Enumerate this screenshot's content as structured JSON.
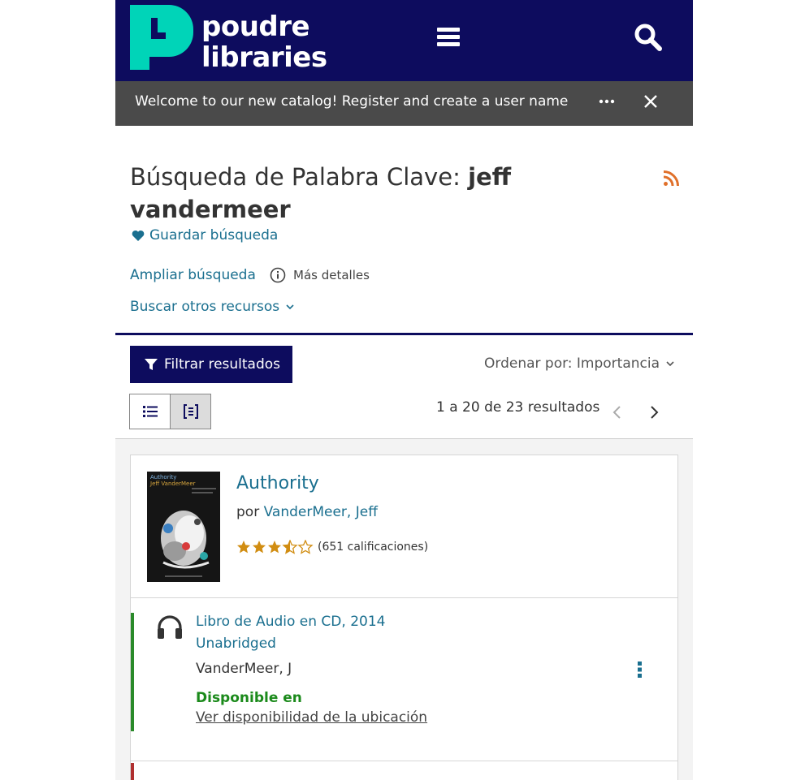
{
  "header": {
    "logo_line1": "poudre",
    "logo_line2": "libraries",
    "menu_icon": "hamburger-menu-icon",
    "search_icon": "search-icon",
    "background_color": "#0d0c5e",
    "logo_accent_color": "#00d4b8"
  },
  "banner": {
    "text": "Welcome to our new catalog! Register and create a user name",
    "more_icon": "ellipsis-icon",
    "close_icon": "close-icon"
  },
  "search": {
    "prefix": "Búsqueda de Palabra Clave: ",
    "term": "jeff vandermeer",
    "save_label": "Guardar búsqueda",
    "expand_label": "Ampliar búsqueda",
    "more_details_label": "Más detalles",
    "other_resources_label": "Buscar otros recursos",
    "rss_icon": "rss-icon"
  },
  "toolbar": {
    "filter_label": "Filtrar resultados",
    "sort_label": "Ordenar por: Importancia",
    "result_count": "1 a 20 de 23 resultados",
    "list_view_icon": "list-view-icon",
    "grouped_view_icon": "grouped-view-icon"
  },
  "results": [
    {
      "title": "Authority",
      "author_prefix": "por ",
      "author": "VanderMeer, Jeff",
      "rating_value": 3.5,
      "rating_max": 5,
      "rating_text": "(651 calificaciones)",
      "cover_title": "Authority",
      "cover_author": "Jeff VanderMeer",
      "formats": [
        {
          "format_line1": "Libro de Audio en CD, 2014",
          "format_line2": "Unabridged",
          "author": "VanderMeer, J",
          "availability": "Disponible en",
          "location_link": "Ver disponibilidad de la ubicación",
          "icon": "headphones-icon"
        }
      ]
    }
  ]
}
